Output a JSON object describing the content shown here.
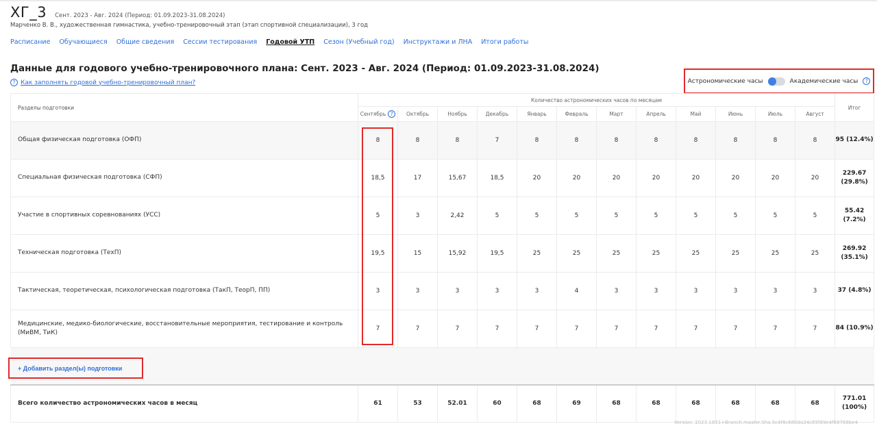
{
  "header": {
    "group_name": "ХГ_3",
    "period": "Сент. 2023 - Авг. 2024 (Период: 01.09.2023-31.08.2024)",
    "subtitle": "Марченко В. В., художественная гимнастика, учебно-тренировочный этап (этап спортивной специализации), 3 год"
  },
  "tabs": [
    {
      "label": "Расписание",
      "active": false
    },
    {
      "label": "Обучающиеся",
      "active": false
    },
    {
      "label": "Общие сведения",
      "active": false
    },
    {
      "label": "Сессии тестирования",
      "active": false
    },
    {
      "label": "Годовой УТП",
      "active": true
    },
    {
      "label": "Сезон (Учебный год)",
      "active": false
    },
    {
      "label": "Инструктажи и ЛНА",
      "active": false
    },
    {
      "label": "Итоги работы",
      "active": false
    }
  ],
  "main": {
    "title": "Данные для годового учебно-тренировочного плана: Сент. 2023 - Авг. 2024 (Период: 01.09.2023-31.08.2024)",
    "help_link": "Как заполнять годовой учебно-тренировочный план?",
    "help_icon": "question-circle-icon"
  },
  "hours_toggle": {
    "left_label": "Астрономические часы",
    "right_label": "Академические часы",
    "state": "astronomical"
  },
  "table": {
    "section_header": "Разделы подготовки",
    "months_group_header": "Количество астрономических часов по месяцам",
    "total_header": "Итог",
    "months": [
      "Сентябрь",
      "Октябрь",
      "Ноябрь",
      "Декабрь",
      "Январь",
      "Февраль",
      "Март",
      "Апрель",
      "Май",
      "Июнь",
      "Июль",
      "Август"
    ],
    "rows": [
      {
        "label": "Общая физическая подготовка (ОФП)",
        "values": [
          "8",
          "8",
          "8",
          "7",
          "8",
          "8",
          "8",
          "8",
          "8",
          "8",
          "8",
          "8"
        ],
        "total": "95 (12.4%)"
      },
      {
        "label": "Специальная физическая подготовка (СФП)",
        "values": [
          "18,5",
          "17",
          "15,67",
          "18,5",
          "20",
          "20",
          "20",
          "20",
          "20",
          "20",
          "20",
          "20"
        ],
        "total": "229.67 (29.8%)"
      },
      {
        "label": "Участие в спортивных соревнованиях (УСС)",
        "values": [
          "5",
          "3",
          "2,42",
          "5",
          "5",
          "5",
          "5",
          "5",
          "5",
          "5",
          "5",
          "5"
        ],
        "total": "55.42 (7.2%)"
      },
      {
        "label": "Техническая подготовка (ТехП)",
        "values": [
          "19,5",
          "15",
          "15,92",
          "19,5",
          "25",
          "25",
          "25",
          "25",
          "25",
          "25",
          "25",
          "25"
        ],
        "total": "269.92 (35.1%)"
      },
      {
        "label": "Тактическая, теоретическая, психологическая подготовка (ТакП, ТеорП, ПП)",
        "values": [
          "3",
          "3",
          "3",
          "3",
          "3",
          "4",
          "3",
          "3",
          "3",
          "3",
          "3",
          "3"
        ],
        "total": "37 (4.8%)"
      },
      {
        "label": "Медицинские, медико-биологические, восстановительные мероприятия, тестирование и контроль (МиВМ, ТиК)",
        "values": [
          "7",
          "7",
          "7",
          "7",
          "7",
          "7",
          "7",
          "7",
          "7",
          "7",
          "7",
          "7"
        ],
        "total": "84 (10.9%)"
      }
    ],
    "add_button": "+ Добавить раздел(ы) подготовки",
    "sum_row": {
      "label": "Всего количество астрономических часов в месяц",
      "values": [
        "61",
        "53",
        "52.01",
        "60",
        "68",
        "69",
        "68",
        "68",
        "68",
        "68",
        "68",
        "68"
      ],
      "total": "771.01 (100%)"
    }
  },
  "footer": {
    "version": "Version: 2023.1851+Branch.master.Sha.9c4f8c680da34c65f89e4f68769be4"
  },
  "colors": {
    "link": "#2f6fd6",
    "highlight": "#e02a2a",
    "toggle_accent": "#3f7fe6"
  }
}
